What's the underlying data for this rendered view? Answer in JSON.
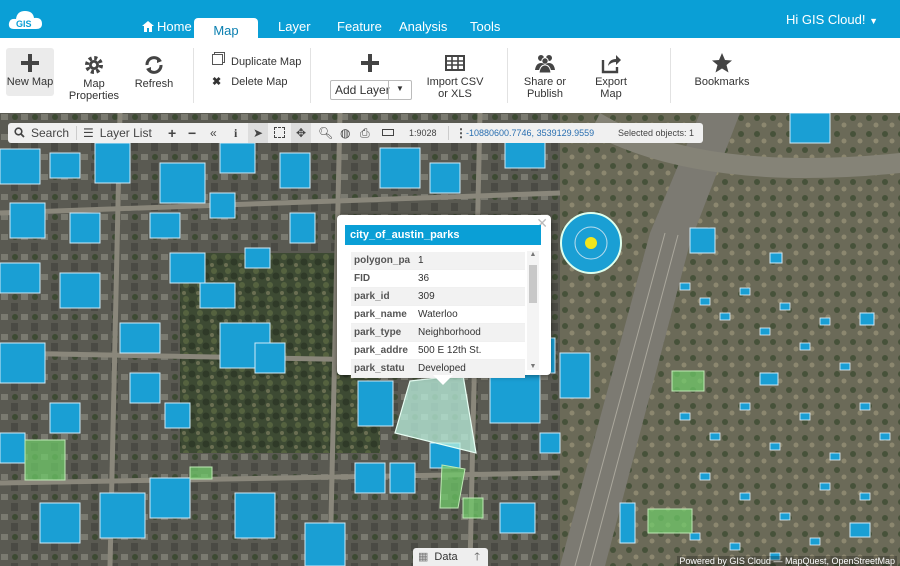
{
  "app": {
    "logo_text": "GIS"
  },
  "nav": {
    "tabs": [
      {
        "label": "Home",
        "icon": "home-icon"
      },
      {
        "label": "Map",
        "active": true
      },
      {
        "label": "Layer"
      },
      {
        "label": "Feature"
      },
      {
        "label": "Analysis"
      },
      {
        "label": "Tools"
      }
    ],
    "user": "Hi GIS Cloud!"
  },
  "ribbon": {
    "new_map": "New Map",
    "map_properties": "Map\nProperties",
    "refresh": "Refresh",
    "duplicate_map": "Duplicate Map",
    "delete_map": "Delete Map",
    "add_layer": "Add Layer",
    "import_csv": "Import CSV\nor XLS",
    "share": "Share or\nPublish",
    "export_map": "Export Map",
    "bookmarks": "Bookmarks"
  },
  "toolbar": {
    "search": "Search",
    "layer_list": "Layer List",
    "scale": "1:9028",
    "coords": "-10880600.7746, 3539129.9559",
    "selected": "Selected objects: 1"
  },
  "popup": {
    "layer": "city_of_austin_parks",
    "rows": [
      {
        "key": "polygon_pa",
        "value": "1"
      },
      {
        "key": "FID",
        "value": "36"
      },
      {
        "key": "park_id",
        "value": "309"
      },
      {
        "key": "park_name",
        "value": "Waterloo"
      },
      {
        "key": "park_type",
        "value": "Neighborhood"
      },
      {
        "key": "park_addre",
        "value": "500 E 12th St."
      },
      {
        "key": "park_statu",
        "value": "Developed"
      }
    ]
  },
  "data_panel": {
    "label": "Data"
  },
  "attribution": "Powered by GIS Cloud — MapQuest, OpenStreetMap",
  "colors": {
    "brand": "#0a9fd6",
    "buildings": "#1a9fd4",
    "parks": "#6fcf6a"
  }
}
